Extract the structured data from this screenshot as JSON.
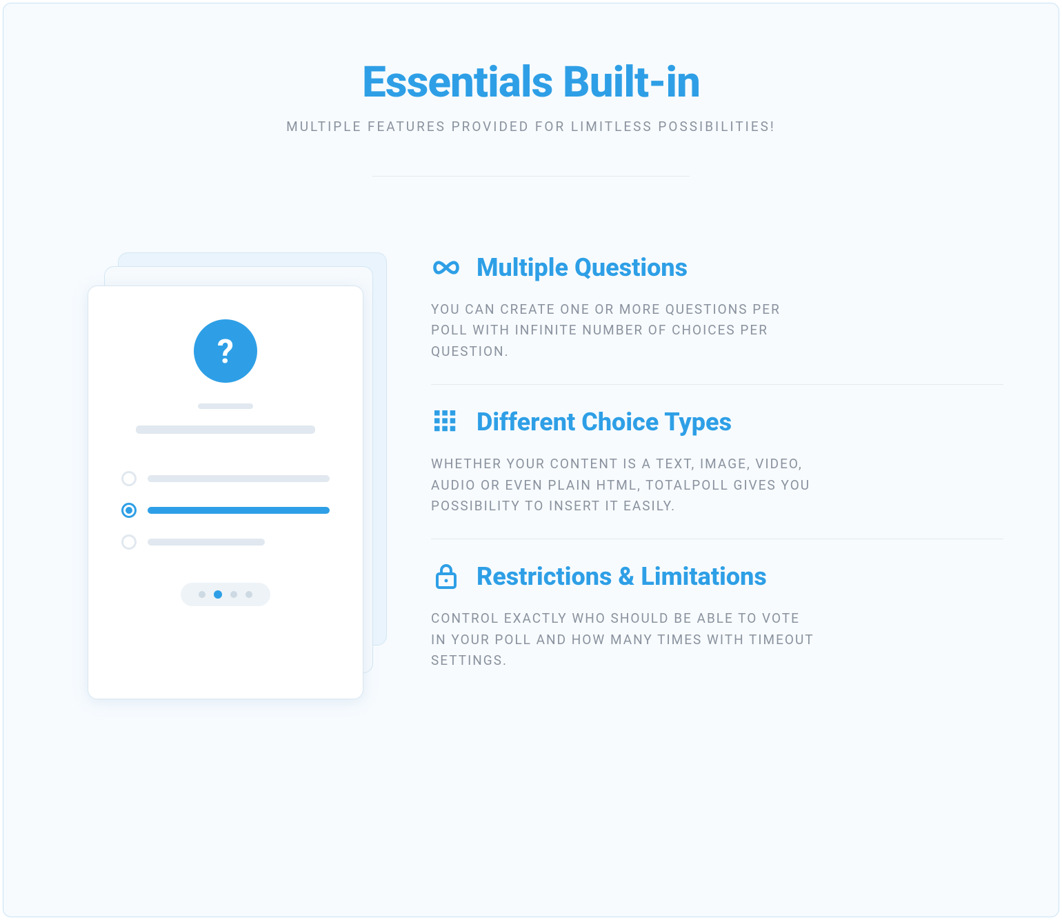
{
  "header": {
    "title": "Essentials Built-in",
    "subtitle": "MULTIPLE FEATURES PROVIDED FOR LIMITLESS POSSIBILITIES!"
  },
  "illustration": {
    "question_mark": "?"
  },
  "features": [
    {
      "icon": "infinity-icon",
      "title": "Multiple Questions",
      "desc": "YOU CAN CREATE ONE OR MORE QUESTIONS PER POLL WITH INFINITE NUMBER OF CHOICES PER QUESTION."
    },
    {
      "icon": "grid-icon",
      "title": "Different Choice Types",
      "desc": "WHETHER YOUR CONTENT IS A TEXT, IMAGE, VIDEO, AUDIO OR EVEN PLAIN HTML, TOTALPOLL GIVES YOU POSSIBILITY TO INSERT IT EASILY."
    },
    {
      "icon": "lock-icon",
      "title": "Restrictions & Limitations",
      "desc": "CONTROL EXACTLY WHO SHOULD BE ABLE TO VOTE IN YOUR POLL AND HOW MANY TIMES WITH TIMEOUT SETTINGS."
    }
  ]
}
